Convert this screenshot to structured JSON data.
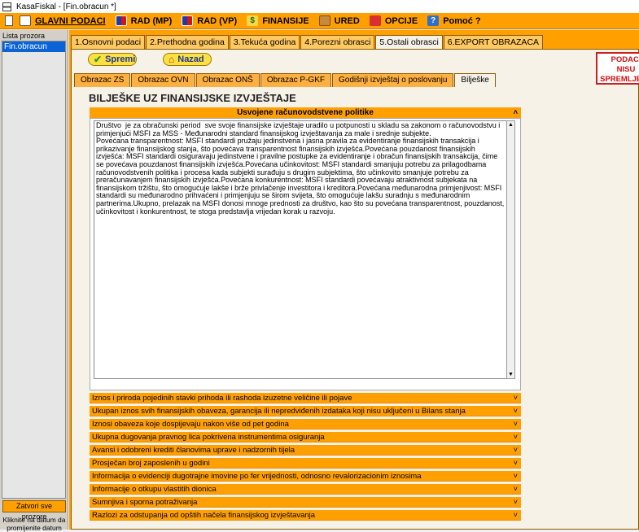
{
  "window": {
    "title": "KasaFiskal  - [Fin.obracun *]"
  },
  "menu": [
    {
      "label": "GLAVNI PODACI",
      "icon": "doc-icon"
    },
    {
      "label": "RAD (MP)",
      "icon": "flag-icon"
    },
    {
      "label": "RAD (VP)",
      "icon": "flag-icon"
    },
    {
      "label": "FINANSIJE",
      "icon": "dollar-icon"
    },
    {
      "label": "URED",
      "icon": "box-icon"
    },
    {
      "label": "OPCIJE",
      "icon": "gear-icon"
    },
    {
      "label": "Pomoć ?",
      "icon": "help-icon"
    }
  ],
  "sidebar": {
    "heading": "Lista prozora",
    "items": [
      "Fin.obracun"
    ],
    "close_all": "Zatvori sve prozore",
    "hint": "Kliknite na datum da promijenite datum"
  },
  "top_tabs": [
    "1.Osnovni podaci",
    "2.Prethodna godina",
    "3.Tekuća godina",
    "4.Porezni obrasci",
    "5.Ostali obrasci",
    "6.EXPORT OBRAZACA"
  ],
  "top_tabs_active": 4,
  "actions": {
    "save": "Spremi",
    "back": "Nazad"
  },
  "status": {
    "line1": "PODACI",
    "line2": "NISU",
    "line3": "SPREMLJENI!",
    "color": "#d01010"
  },
  "sub_tabs": [
    "Obrazac ZS",
    "Obrazac OVN",
    "Obrazac ONŠ",
    "Obrazac P-GKF",
    "Godišnji izvještaj o poslovanju",
    "Bilješke"
  ],
  "sub_tabs_active": 5,
  "page_title": "BILJEŠKE UZ FINANSIJSKE IZVJEŠTAJE",
  "open_section": {
    "title": "Usvojene računovodstvene politike",
    "text": "Društvo  je za obračunski period  sve svoje finansijske izvještaje uradilo u potpunosti u skladu sa zakonom o računovodstvu i primjenjući MSFI za MSS - Međunarodni standard finansijskog izvještavanja za male i srednje subjekte.\nPovećana transparentnost: MSFI standardi pružaju jedinstvena i jasna pravila za evidentiranje finansijskih transakcija i prikazivanje finansijskog stanja, što povećava transparentnost finansijskih izvješća.Povećana pouzdanost finansijskih izvješća: MSFI standardi osiguravaju jedinstvene i pravilne postupke za evidentiranje i obračun finansijskih transakcija, čime se povećava pouzdanost finansijskih izvješća.Povećana učinkovitost: MSFI standardi smanjuju potrebu za prilagodbama računovodstvenih politika i procesa kada subjekti surađuju s drugim subjektima, što učinkovito smanjuje potrebu za preračunavanjem finansijskih izvješća.Povećana konkurentnost: MSFI standardi povećavaju atraktivnost subjekata na finansijskom tržištu, što omogućuje lakše i brže privlačenje investitora i kreditora.Povećana međunarodna primjenjivost: MSFI standardi su međunarodno prihvaćeni i primjenjuju se širom svijeta, što omogućuje lakšu suradnju s međunarodnim partnerima.Ukupno, prelazak na MSFI donosi mnoge prednosti za društvo, kao što su povećana transparentnost, pouzdanost, učinkovitost i konkurentnost, te stoga predstavlja vrijedan korak u razvoju."
  },
  "collapsed_sections": [
    "Iznos i priroda pojedinih stavki prihoda ili rashoda izuzetne veličine ili pojave",
    "Ukupan iznos svih finansijskih obaveza, garancija ili nepredviđenih izdataka koji nisu uključeni u Bilans stanja",
    "Iznosi obaveza koje dospijevaju nakon više od pet godina",
    "Ukupna dugovanja pravnog lica pokrivena instrumentima osiguranja",
    "Avansi i odobreni krediti članovima uprave i nadzornih tijela",
    "Prosječan broj zaposlenih u godini",
    "Informacija o evidenciji dugotrajne imovine po fer vrijednosti, odnosno revalorizacionim iznosima",
    "Informacije o otkupu vlastitih dionica",
    "Sumnjiva i sporna potraživanja",
    "Razlozi za odstupanja od opštih načela finansijskog izvještavanja"
  ]
}
